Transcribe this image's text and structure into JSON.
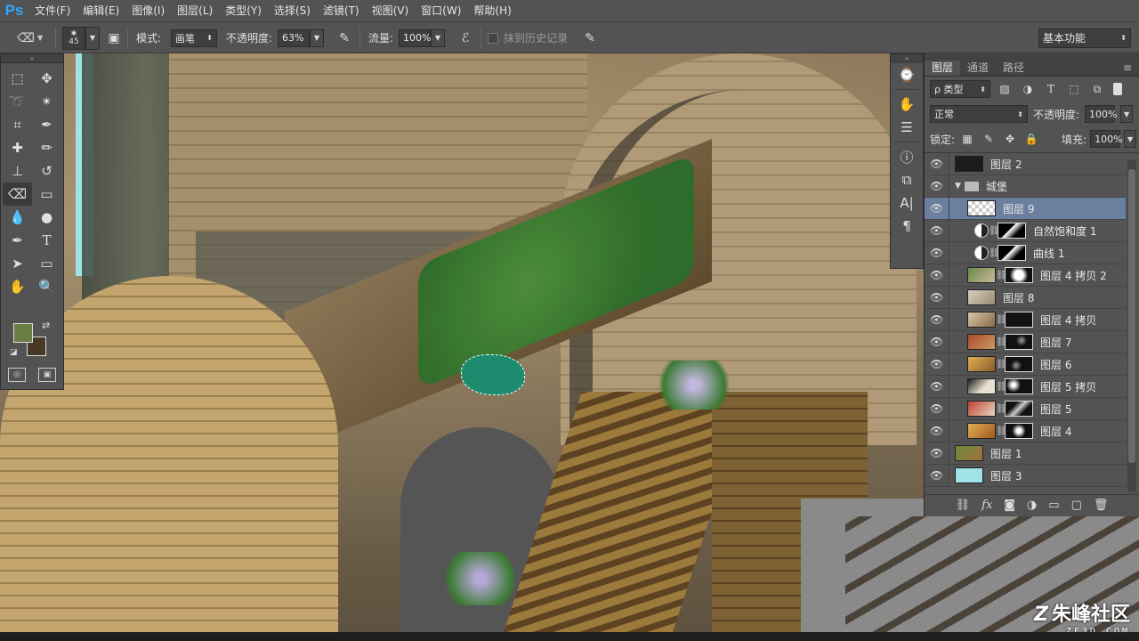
{
  "app": {
    "logo": "Ps"
  },
  "menu": [
    "文件(F)",
    "编辑(E)",
    "图像(I)",
    "图层(L)",
    "类型(Y)",
    "选择(S)",
    "滤镜(T)",
    "视图(V)",
    "窗口(W)",
    "帮助(H)"
  ],
  "options": {
    "brush_size": "45",
    "mode_label": "模式:",
    "mode_value": "画笔",
    "opacity_label": "不透明度:",
    "opacity_value": "63%",
    "flow_label": "流量:",
    "flow_value": "100%",
    "erase_history_label": "抹到历史记录",
    "workspace": "基本功能"
  },
  "layers_panel": {
    "tabs": [
      "图层",
      "通道",
      "路径"
    ],
    "filter_kind": "ρ 类型",
    "blend_mode": "正常",
    "opacity_label": "不透明度:",
    "opacity_value": "100%",
    "lock_label": "锁定:",
    "fill_label": "填充:",
    "fill_value": "100%",
    "layers": [
      {
        "name": "图层 2"
      },
      {
        "name": "城堡"
      },
      {
        "name": "图层 9"
      },
      {
        "name": "自然饱和度 1"
      },
      {
        "name": "曲线 1"
      },
      {
        "name": "图层 4 拷贝 2"
      },
      {
        "name": "图层 8"
      },
      {
        "name": "图层 4 拷贝"
      },
      {
        "name": "图层 7"
      },
      {
        "name": "图层 6"
      },
      {
        "name": "图层 5 拷贝"
      },
      {
        "name": "图层 5"
      },
      {
        "name": "图层 4"
      },
      {
        "name": "图层 1"
      },
      {
        "name": "图层 3"
      }
    ]
  },
  "watermark": {
    "title": "朱峰社区",
    "subtitle": "ZF3D.COM"
  },
  "colors": {
    "foreground": "#6b7c45",
    "background": "#4a3826",
    "selected_layer": "#6b7f9e"
  }
}
